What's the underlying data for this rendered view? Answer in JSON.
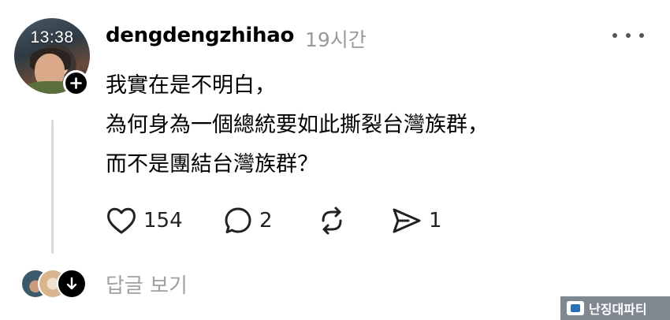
{
  "post": {
    "avatar_clock": "13:38",
    "username": "dengdengzhihao",
    "time": "19시간",
    "text_lines": [
      "我實在是不明白，",
      "為何身為一個總統要如此撕裂台灣族群，",
      "而不是團結台灣族群？"
    ]
  },
  "actions": {
    "likes": "154",
    "comments": "2",
    "reposts": "",
    "shares": "1"
  },
  "replies": {
    "view_label": "답글 보기"
  },
  "watermark": {
    "text": "난징대파티"
  },
  "icons": {
    "plus": "plus-icon",
    "more": "more-horizontal-icon",
    "like": "heart-icon",
    "comment": "comment-bubble-icon",
    "repost": "repost-icon",
    "share": "send-icon",
    "expand": "arrow-down-icon"
  },
  "colors": {
    "text": "#000000",
    "muted": "#9a9a9a",
    "thread_line": "#d9d9d9"
  }
}
